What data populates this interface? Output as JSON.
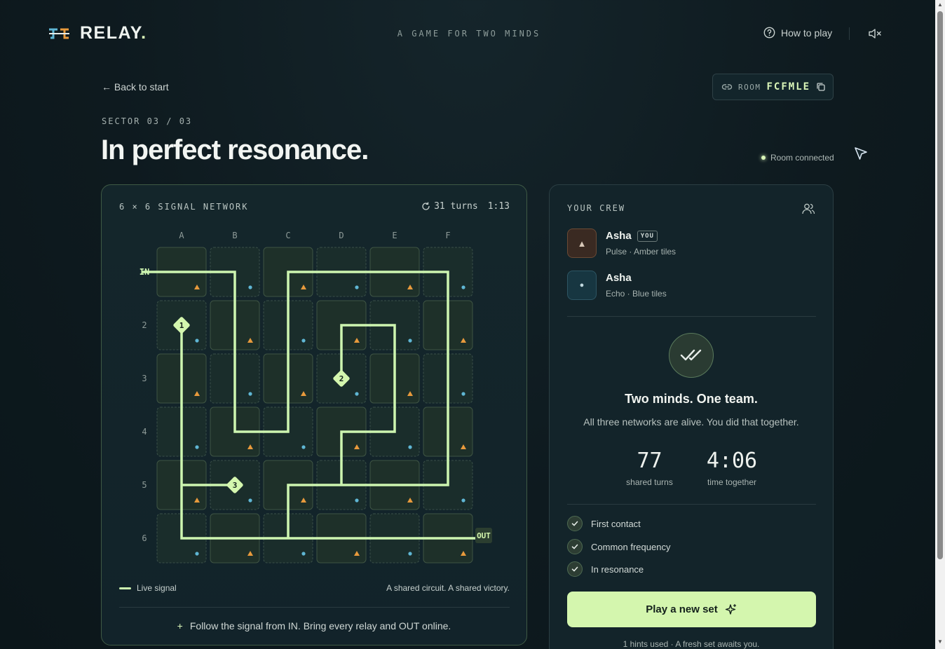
{
  "header": {
    "brand": "RELAY",
    "brand_dot": ".",
    "tagline": "A GAME FOR TWO MINDS",
    "how_to_play": "How to play"
  },
  "nav": {
    "back": "← Back to start",
    "room_label": "ROOM",
    "room_code": "FCFMLE",
    "connection_status": "Room connected"
  },
  "level": {
    "sector": "SECTOR 03 / 03",
    "title": "In perfect resonance."
  },
  "board": {
    "heading": "6 × 6 SIGNAL NETWORK",
    "turns": "31 turns",
    "timer": "1:13",
    "columns": [
      "A",
      "B",
      "C",
      "D",
      "E",
      "F"
    ],
    "rows": [
      "IN",
      "2",
      "3",
      "4",
      "5",
      "6"
    ],
    "out_label": "OUT",
    "relays": [
      {
        "label": "1",
        "col": 0,
        "row": 1
      },
      {
        "label": "2",
        "col": 3,
        "row": 2
      },
      {
        "label": "3",
        "col": 1,
        "row": 4
      }
    ],
    "legend_live": "Live signal",
    "legend_right": "A shared circuit. A shared victory.",
    "footer": "Follow the signal from IN. Bring every relay and OUT online.",
    "footer_plus": "+",
    "signal_color": "#cdf5b0",
    "amber_color": "#e89a3c",
    "blue_color": "#5fb6d4"
  },
  "crew": {
    "heading": "YOUR CREW",
    "members": [
      {
        "name": "Asha",
        "tag": "YOU",
        "role": "Pulse · Amber tiles",
        "glyph": "▲"
      },
      {
        "name": "Asha",
        "tag": "",
        "role": "Echo · Blue tiles",
        "glyph": "●"
      }
    ],
    "win_title": "Two minds. One team.",
    "win_subtitle": "All three networks are alive. You did that together.",
    "stats": [
      {
        "value": "77",
        "label": "shared turns"
      },
      {
        "value": "4:06",
        "label": "time together"
      }
    ],
    "achievements": [
      "First contact",
      "Common frequency",
      "In resonance"
    ],
    "play_button": "Play a new set",
    "hints": "1 hints used · A fresh set awaits you."
  }
}
